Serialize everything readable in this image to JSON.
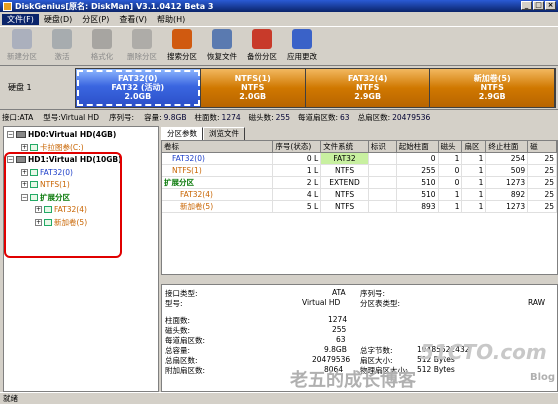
{
  "window": {
    "title": "DiskGenius[原名: DiskMan] V3.1.0412 Beta 3",
    "controls": [
      "_",
      "□",
      "×"
    ]
  },
  "menu": [
    "文件(F)",
    "硬盘(D)",
    "分区(P)",
    "查看(V)",
    "帮助(H)"
  ],
  "toolbar": [
    {
      "label": "新建分区",
      "icon": "new-partition-icon",
      "enabled": false,
      "color": "#7a8ab0"
    },
    {
      "label": "激活",
      "icon": "activate-icon",
      "enabled": false,
      "color": "#708090"
    },
    {
      "label": "格式化",
      "icon": "format-icon",
      "enabled": false,
      "color": "#707070"
    },
    {
      "label": "删除分区",
      "icon": "delete-partition-icon",
      "enabled": false,
      "color": "#808080"
    },
    {
      "label": "搜索分区",
      "icon": "search-partition-icon",
      "enabled": true,
      "color": "#d05a10"
    },
    {
      "label": "恢复文件",
      "icon": "recover-file-icon",
      "enabled": true,
      "color": "#5a7ab0"
    },
    {
      "label": "备份分区",
      "icon": "backup-partition-icon",
      "enabled": true,
      "color": "#c83a2a"
    },
    {
      "label": "应用更改",
      "icon": "apply-changes-icon",
      "enabled": true,
      "color": "#3a62c8"
    }
  ],
  "diskmap": {
    "disk_label": "硬盘 1",
    "partitions": [
      {
        "name": "FAT32(0)",
        "sub": "FAT32 (活动)",
        "size": "2.0GB",
        "kind": "sel"
      },
      {
        "name": "NTFS(1)",
        "sub": "NTFS",
        "size": "2.0GB",
        "kind": "ntfs"
      },
      {
        "name": "FAT32(4)",
        "sub": "NTFS",
        "size": "2.9GB",
        "kind": "ntfs"
      },
      {
        "name": "新加卷(5)",
        "sub": "NTFS",
        "size": "2.9GB",
        "kind": "ntfs"
      }
    ]
  },
  "infobar": [
    {
      "k": "接口:ATA",
      "v": ""
    },
    {
      "k": "型号:Virtual HD",
      "v": ""
    },
    {
      "k": "序列号:",
      "v": ""
    },
    {
      "k": "容量:",
      "v": "9.8GB"
    },
    {
      "k": "柱面数:",
      "v": "1274"
    },
    {
      "k": "磁头数:",
      "v": "255"
    },
    {
      "k": "每道扇区数:",
      "v": "63"
    },
    {
      "k": "总扇区数:",
      "v": "20479536"
    }
  ],
  "tree": [
    {
      "text": "HD0:Virtual HD(4GB)",
      "cls": "t-bold",
      "exp": "−",
      "icon": "hd",
      "indent": 0
    },
    {
      "text": "卡拉图参(C:)",
      "cls": "t-orange",
      "exp": "+",
      "icon": "pt",
      "indent": 14
    },
    {
      "text": "HD1:Virtual HD(10GB)",
      "cls": "t-bold",
      "exp": "−",
      "icon": "hd",
      "indent": 0
    },
    {
      "text": "FAT32(0)",
      "cls": "t-blue",
      "exp": "+",
      "icon": "pt",
      "indent": 14
    },
    {
      "text": "NTFS(1)",
      "cls": "t-orange",
      "exp": "+",
      "icon": "pt",
      "indent": 14
    },
    {
      "text": "扩展分区",
      "cls": "t-green",
      "exp": "−",
      "icon": "pt",
      "indent": 14
    },
    {
      "text": "FAT32(4)",
      "cls": "t-orange",
      "exp": "+",
      "icon": "pt",
      "indent": 28
    },
    {
      "text": "新加卷(5)",
      "cls": "t-orange",
      "exp": "+",
      "icon": "pt",
      "indent": 28
    }
  ],
  "tabs": [
    "分区参数",
    "浏览文件"
  ],
  "table": {
    "headers": [
      "卷标",
      "序号(状态)",
      "文件系统",
      "标识",
      "起始柱面",
      "磁头",
      "扇区",
      "终止柱面",
      "磁"
    ],
    "rows": [
      {
        "label": "FAT32(0)",
        "cls": "t-blue",
        "indent": 10,
        "seq": "0",
        "st": "L",
        "fs": "FAT32",
        "fsHL": true,
        "id": "",
        "sc": "0",
        "h": "1",
        "s": "1",
        "ec": "254",
        "m": "25"
      },
      {
        "label": "NTFS(1)",
        "cls": "t-orange",
        "indent": 10,
        "seq": "1",
        "st": "L",
        "fs": "NTFS",
        "fsHL": false,
        "id": "",
        "sc": "255",
        "h": "0",
        "s": "1",
        "ec": "509",
        "m": "25"
      },
      {
        "label": "扩展分区",
        "cls": "t-green",
        "indent": 2,
        "seq": "2",
        "st": "L",
        "fs": "EXTEND",
        "fsHL": false,
        "id": "",
        "sc": "510",
        "h": "0",
        "s": "1",
        "ec": "1273",
        "m": "25"
      },
      {
        "label": "FAT32(4)",
        "cls": "t-orange",
        "indent": 18,
        "seq": "4",
        "st": "L",
        "fs": "NTFS",
        "fsHL": false,
        "id": "",
        "sc": "510",
        "h": "1",
        "s": "1",
        "ec": "892",
        "m": "25"
      },
      {
        "label": "新加卷(5)",
        "cls": "t-orange",
        "indent": 18,
        "seq": "5",
        "st": "L",
        "fs": "NTFS",
        "fsHL": false,
        "id": "",
        "sc": "893",
        "h": "1",
        "s": "1",
        "ec": "1273",
        "m": "25"
      }
    ]
  },
  "details": {
    "iface_k": "接口类型:",
    "iface_v": "ATA",
    "serial_k": "序列号:",
    "serial_v": "",
    "model_k": "型号:",
    "model_v": "Virtual HD",
    "ptype_k": "分区表类型:",
    "ptype_v": "RAW",
    "cyl_k": "柱面数:",
    "cyl_v": "1274",
    "head_k": "磁头数:",
    "head_v": "255",
    "spt_k": "每道扇区数:",
    "spt_v": "63",
    "cap_k": "总容量:",
    "cap_v": "9.8GB",
    "bytes_k": "总字节数:",
    "bytes_v": "10485522432",
    "sect_k": "总扇区数:",
    "sect_v": "20479536",
    "ssize_k": "扇区大小:",
    "ssize_v": "512 Bytes",
    "add_k": "附加扇区数:",
    "add_v": "8064",
    "psize_k": "物理扇区大小:",
    "psize_v": "512 Bytes"
  },
  "status": "就绪",
  "watermark": {
    "site": "51CTO.com",
    "blog_text": "老五的成长博客",
    "blog_suffix": "Blog"
  }
}
